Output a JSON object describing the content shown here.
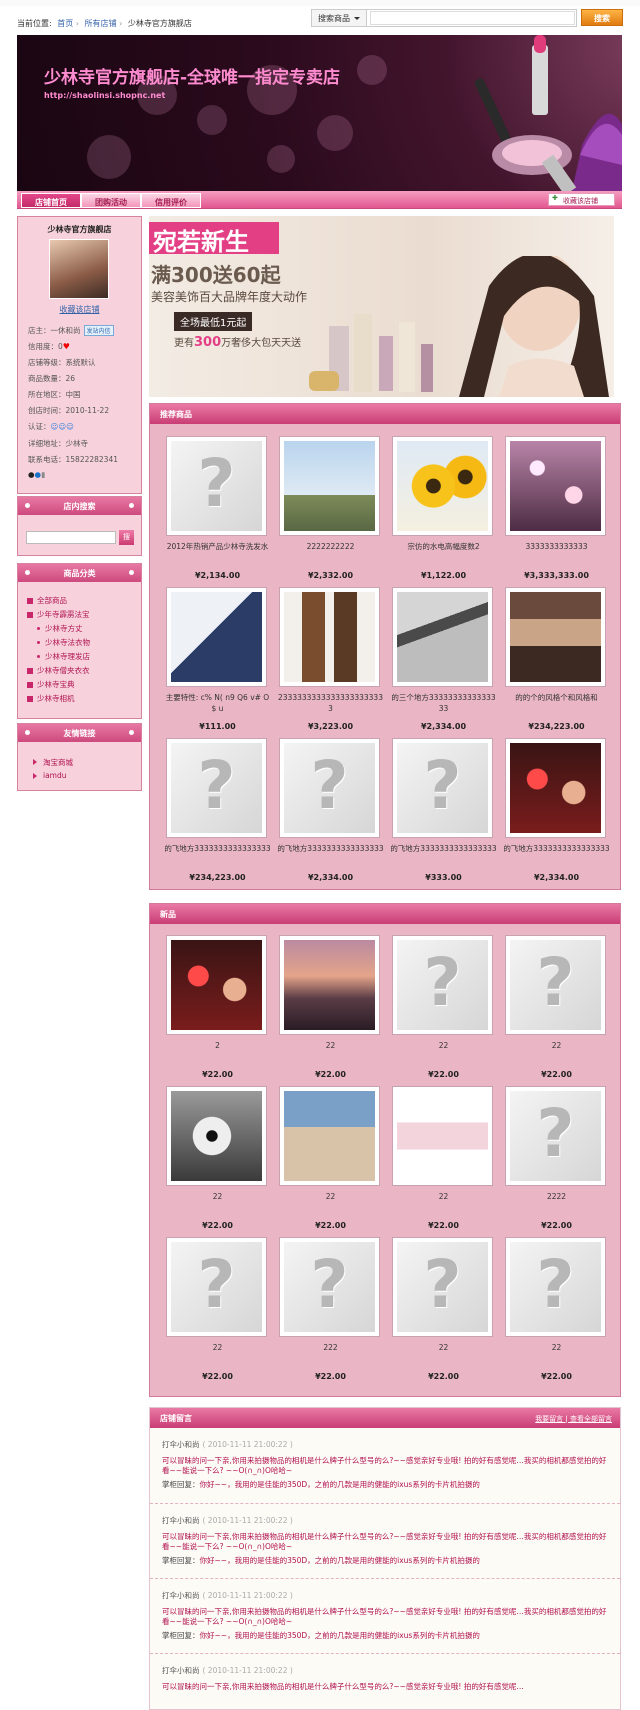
{
  "header": {
    "crumb_label": "当前位置:",
    "crumbs": [
      "首页",
      "所有店铺",
      "少林寺官方旗舰店"
    ],
    "search_scope": "搜索商品",
    "search_button": "搜索"
  },
  "banner": {
    "title": "少林寺官方旗舰店-全球唯一指定专卖店",
    "url": "http://shaolinsi.shopnc.net"
  },
  "nav": {
    "tabs": [
      "店铺首页",
      "团购活动",
      "信用评价"
    ],
    "favorite": "收藏该店铺"
  },
  "shop": {
    "name": "少林寺官方旗舰店",
    "favorite_link": "收藏该店铺",
    "info": [
      {
        "label": "店主：",
        "value": "一休和尚",
        "badge": "发站内信"
      },
      {
        "label": "信用度：",
        "value": "0"
      },
      {
        "label": "店铺等级：",
        "value": "系统默认"
      },
      {
        "label": "商品数量：",
        "value": "26"
      },
      {
        "label": "所在地区：",
        "value": "中国"
      },
      {
        "label": "创店时间：",
        "value": "2010-11-22"
      },
      {
        "label": "认证：",
        "value": ""
      },
      {
        "label": "详细地址：",
        "value": "少林寺"
      },
      {
        "label": "联系电话：",
        "value": "15822282341"
      }
    ]
  },
  "sidebar": {
    "search_title": "店内搜索",
    "search_button": "搜",
    "cat_title": "商品分类",
    "categories": [
      {
        "name": "全部商品",
        "sub": false
      },
      {
        "name": "少年寺霹雳法宝",
        "sub": false
      },
      {
        "name": "少林寺方丈",
        "sub": true
      },
      {
        "name": "少林寺法衣物",
        "sub": true
      },
      {
        "name": "少林寺理发店",
        "sub": true
      },
      {
        "name": "少林寺僧夹衣衣",
        "sub": false
      },
      {
        "name": "少林寺宝典",
        "sub": false
      },
      {
        "name": "少林寺相机",
        "sub": false
      }
    ],
    "links_title": "友情链接",
    "links": [
      "淘宝商城",
      "iamdu"
    ]
  },
  "recommended": {
    "title": "推荐商品",
    "items": [
      {
        "name": "2012年热销产品少林寺洗发水",
        "price": "¥2,134.00",
        "img": "q"
      },
      {
        "name": "2222222222",
        "price": "¥2,332.00",
        "img": "lighthouse"
      },
      {
        "name": "宗仿的水电高幅度数2",
        "price": "¥1,122.00",
        "img": "sunflower"
      },
      {
        "name": "3333333333333",
        "price": "¥3,333,333.00",
        "img": "bokeh"
      },
      {
        "name": "主要特性: c% N( n9 Q6 v# O$ u",
        "price": "¥111.00",
        "img": "jewelry"
      },
      {
        "name": "23333333333333333333333",
        "price": "¥3,223.00",
        "img": "fashion"
      },
      {
        "name": "的三个地方3333333333333333",
        "price": "¥2,334.00",
        "img": "books"
      },
      {
        "name": "的的个的风格个和风格和",
        "price": "¥234,223.00",
        "img": "room"
      },
      {
        "name": "的飞地方3333333333333333",
        "price": "¥234,223.00",
        "img": "q"
      },
      {
        "name": "的飞地方3333333333333333",
        "price": "¥2,334.00",
        "img": "q"
      },
      {
        "name": "的飞地方3333333333333333",
        "price": "¥333.00",
        "img": "q"
      },
      {
        "name": "的飞地方3333333333333333",
        "price": "¥2,334.00",
        "img": "party"
      }
    ]
  },
  "newitems": {
    "title": "新品",
    "items": [
      {
        "name": "2",
        "price": "¥22.00",
        "img": "party"
      },
      {
        "name": "22",
        "price": "¥22.00",
        "img": "sunset"
      },
      {
        "name": "22",
        "price": "¥22.00",
        "img": "q"
      },
      {
        "name": "22",
        "price": "¥22.00",
        "img": "q"
      },
      {
        "name": "22",
        "price": "¥22.00",
        "img": "flower"
      },
      {
        "name": "22",
        "price": "¥22.00",
        "img": "girl"
      },
      {
        "name": "22",
        "price": "¥22.00",
        "img": "ad"
      },
      {
        "name": "2222",
        "price": "¥22.00",
        "img": "q"
      },
      {
        "name": "22",
        "price": "¥22.00",
        "img": "q"
      },
      {
        "name": "222",
        "price": "¥22.00",
        "img": "q"
      },
      {
        "name": "22",
        "price": "¥22.00",
        "img": "q"
      },
      {
        "name": "22",
        "price": "¥22.00",
        "img": "q"
      }
    ]
  },
  "messages": {
    "title": "店铺留言",
    "link1": "我要留言",
    "link2": "查看全部留言",
    "items": [
      {
        "who": "打伞小和尚",
        "time": "( 2010-11-11 21:00:22 )",
        "q": "可以冒昧的问一下亲,你用来拍摄物品的相机是什么牌子什么型号的么?~~感觉亲好专业哦! 拍的好有感觉呢…我买的相机都感觉拍的好看~~能说一下么? ~~O(∩_∩)O哈哈~",
        "a_label": "掌柜回复：",
        "a": "你好~~，我用的是佳能的350D，之前的几款是用的健能的ixus系列的卡片机拍摄的"
      },
      {
        "who": "打伞小和尚",
        "time": "( 2010-11-11 21:00:22 )",
        "q": "可以冒昧的问一下亲,你用来拍摄物品的相机是什么牌子什么型号的么?~~感觉亲好专业哦! 拍的好有感觉呢…我买的相机都感觉拍的好看~~能说一下么? ~~O(∩_∩)O哈哈~",
        "a_label": "掌柜回复：",
        "a": "你好~~，我用的是佳能的350D，之前的几款是用的健能的ixus系列的卡片机拍摄的"
      },
      {
        "who": "打伞小和尚",
        "time": "( 2010-11-11 21:00:22 )",
        "q": "可以冒昧的问一下亲,你用来拍摄物品的相机是什么牌子什么型号的么?~~感觉亲好专业哦! 拍的好有感觉呢…我买的相机都感觉拍的好看~~能说一下么? ~~O(∩_∩)O哈哈~",
        "a_label": "掌柜回复：",
        "a": "你好~~，我用的是佳能的350D，之前的几款是用的健能的ixus系列的卡片机拍摄的"
      },
      {
        "who": "打伞小和尚",
        "time": "( 2010-11-11 21:00:22 )",
        "q": "可以冒昧的问一下亲,你用来拍摄物品的相机是什么牌子什么型号的么?~~感觉亲好专业哦! 拍的好有感觉呢…",
        "a_label": "",
        "a": ""
      }
    ]
  },
  "promo": {
    "title": "宛若新生",
    "headline": "满300送60起",
    "line2": "美容美饰百大品牌年度大动作",
    "tag": "全场最低1元起",
    "line3_a": "更有",
    "line3_b": "300",
    "line3_c": "万奢侈大包天天送"
  },
  "colors": {
    "brand": "#c93d74",
    "price": "#222222",
    "link": "#3362a8"
  }
}
